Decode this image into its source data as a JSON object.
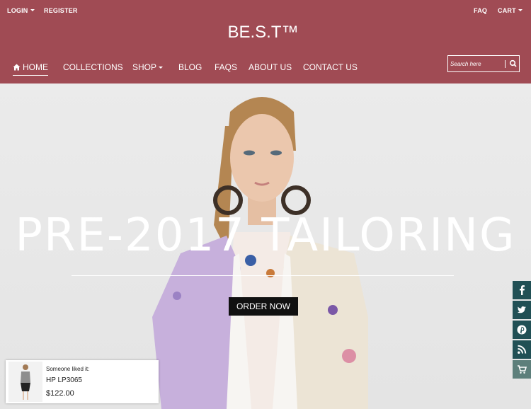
{
  "topbar": {
    "login": "LOGIN",
    "register": "REGISTER",
    "faq": "FAQ",
    "cart": "CART"
  },
  "brand": "BE.S.T™",
  "nav": {
    "home": "HOME",
    "collections": "COLLECTIONS",
    "shop": "SHOP",
    "blog": "BLOG",
    "faqs": "FAQS",
    "about": "ABOUT US",
    "contact": "CONTACT US"
  },
  "search": {
    "placeholder": "Search here"
  },
  "hero": {
    "headline": "PRE-2017 TAILORING",
    "cta": "ORDER NOW"
  },
  "social": [
    "facebook-icon",
    "twitter-icon",
    "pinterest-icon",
    "rss-icon",
    "cart-icon"
  ],
  "popup": {
    "caption": "Someone liked it:",
    "product": "HP LP3065",
    "price": "$122.00"
  },
  "colors": {
    "header": "#a04b54",
    "social": "#215055",
    "social_cart": "#5d7f7b"
  }
}
